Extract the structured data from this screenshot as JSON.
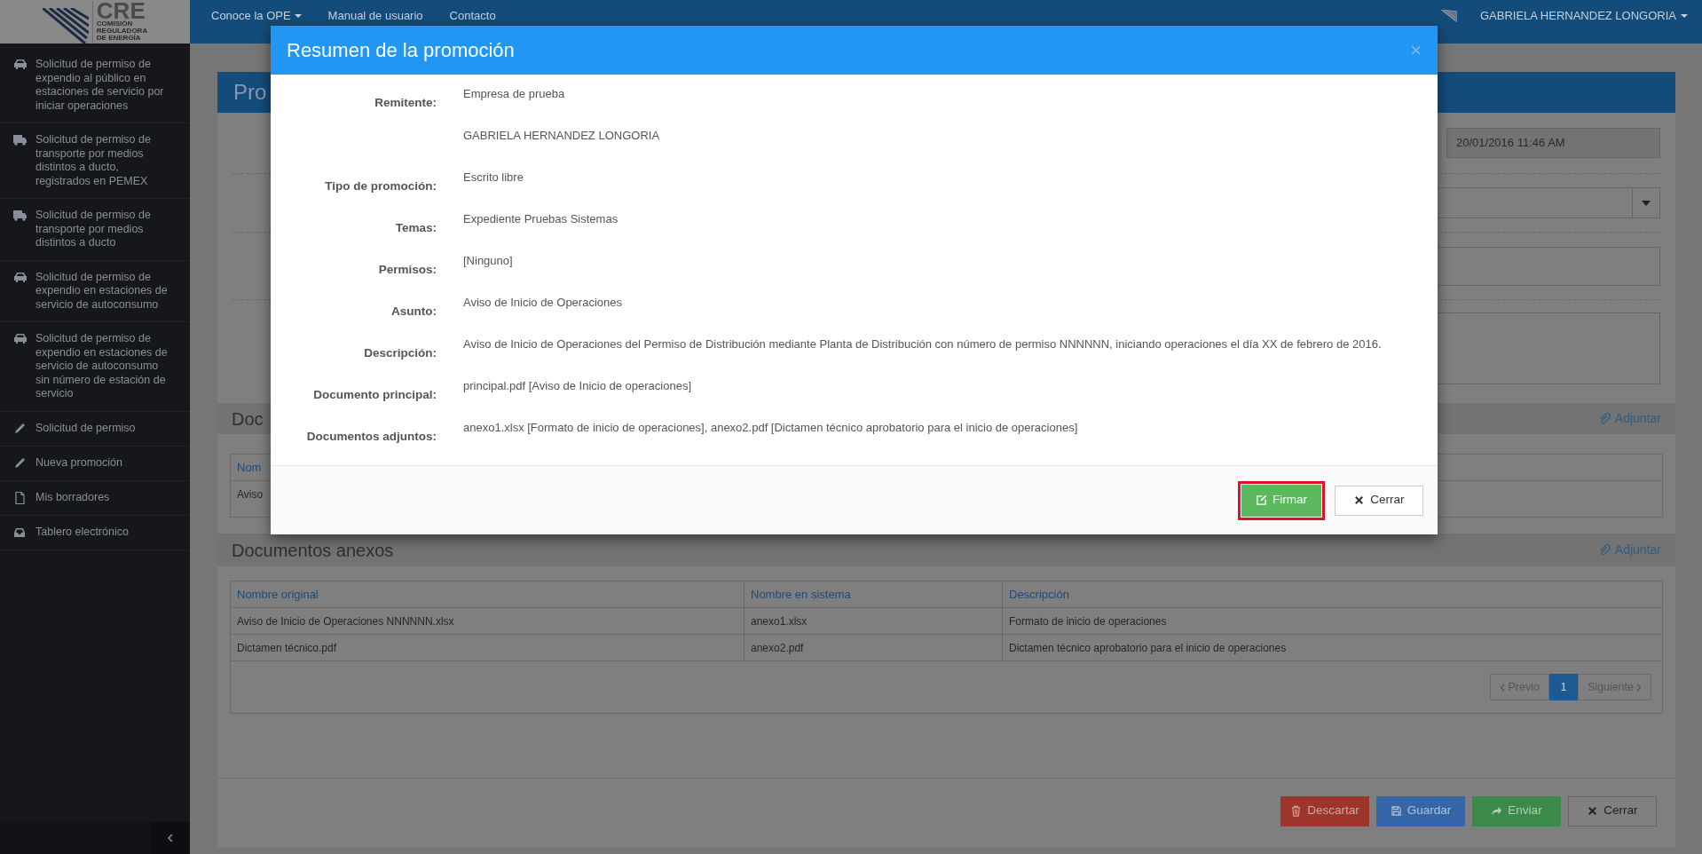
{
  "sidebar": {
    "logo": {
      "wordmark": "CRE",
      "subtitle": [
        "COMISIÓN",
        "REGULADORA",
        "DE ENERGÍA"
      ]
    },
    "items": [
      {
        "kind": "car",
        "label": "Solicitud de permiso de expendio al público en estaciones de servicio por iniciar operaciones"
      },
      {
        "kind": "truck",
        "label": "Solicitud de permiso de transporte por medios distintos a ducto, registrados en PEMEX"
      },
      {
        "kind": "truck",
        "label": "Solicitud de permiso de transporte por medios distintos a ducto"
      },
      {
        "kind": "car",
        "label": "Solicitud de permiso de expendio en estaciones de servicio de autoconsumo"
      },
      {
        "kind": "car",
        "label": "Solicitud de permiso de expendio en estaciones de servicio de autoconsumo sin número de estación de servicio"
      },
      {
        "kind": "pencil",
        "label": "Solicitud de permiso"
      },
      {
        "kind": "pencil",
        "label": "Nueva promoción"
      },
      {
        "kind": "file",
        "label": "Mis borradores"
      },
      {
        "kind": "inbox",
        "label": "Tablero electrónico"
      }
    ]
  },
  "top_nav": {
    "links": [
      {
        "label": "Conoce la OPE",
        "dropdown": true
      },
      {
        "label": "Manual de usuario",
        "dropdown": false
      },
      {
        "label": "Contacto",
        "dropdown": false
      }
    ],
    "user": {
      "name": "GABRIELA HERNANDEZ LONGORIA",
      "dropdown": true
    }
  },
  "page": {
    "title": "Pro",
    "date_field": {
      "value": "20/01/2016 11:46 AM"
    },
    "document_section": {
      "title": "Doc",
      "attach": "Adjuntar",
      "table": {
        "columns": [
          "Nom"
        ],
        "rows": [
          [
            "Aviso"
          ]
        ]
      }
    },
    "annexes": {
      "title": "Documentos anexos",
      "attach": "Adjuntar",
      "table": {
        "columns": [
          "Nombre original",
          "Nombre en sistema",
          "Descripción"
        ],
        "rows": [
          [
            "Aviso de Inicio de Operaciones NNNNNN.xlsx",
            "anexo1.xlsx",
            "Formato de inicio de operaciones"
          ],
          [
            "Dictamen técnico.pdf",
            "anexo2.pdf",
            "Dictamen técnico aprobatorio para el inicio de operaciones"
          ]
        ]
      },
      "pagination": {
        "previous": "Previo",
        "pages": [
          {
            "label": "1",
            "selected": true
          }
        ],
        "next": "Siguiente"
      }
    },
    "actions": [
      {
        "kind": "discard",
        "label": "Descartar"
      },
      {
        "kind": "save",
        "label": "Guardar"
      },
      {
        "kind": "send",
        "label": "Enviar"
      },
      {
        "kind": "close",
        "label": "Cerrar"
      }
    ]
  },
  "modal": {
    "title": "Resumen de la promoción",
    "close": "×",
    "fields": [
      {
        "label": "Remitente:",
        "value": "Empresa de prueba"
      },
      {
        "value": "GABRIELA HERNANDEZ LONGORIA"
      },
      {
        "label": "Tipo de promoción:",
        "value": "Escrito libre"
      },
      {
        "label": "Temas:",
        "value": "Expediente Pruebas Sistemas"
      },
      {
        "label": "Permisos:",
        "value": "[Ninguno]"
      },
      {
        "label": "Asunto:",
        "value": "Aviso de Inicio de Operaciones"
      },
      {
        "label": "Descripción:",
        "value": "Aviso de Inicio de Operaciones del Permiso de Distribución mediante Planta de Distribución con número de permiso NNNNNN, iniciando operaciones el día XX de febrero de 2016."
      },
      {
        "label": "Documento principal:",
        "value": "principal.pdf [Aviso de Inicio de operaciones]"
      },
      {
        "label": "Documentos adjuntos:",
        "value": "anexo1.xlsx [Formato de inicio de operaciones], anexo2.pdf [Dictamen técnico aprobatorio para el inicio de operaciones]"
      }
    ],
    "buttons": [
      {
        "kind": "sign",
        "label": "Firmar",
        "highlighted": true
      },
      {
        "kind": "close",
        "label": "Cerrar",
        "highlighted": false
      }
    ]
  }
}
